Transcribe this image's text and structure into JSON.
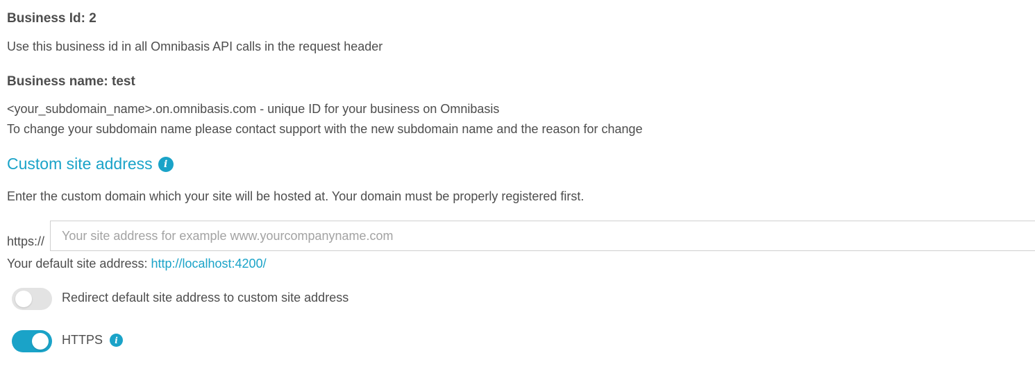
{
  "business": {
    "id_label": "Business Id: 2",
    "id_description": "Use this business id in all Omnibasis API calls in the request header",
    "name_label": "Business name: test",
    "subdomain_line": "<your_subdomain_name>.on.omnibasis.com - unique ID for your business on Omnibasis",
    "subdomain_change_note": "To change your subdomain name please contact support with the new subdomain name and the reason for change"
  },
  "custom_site": {
    "title": "Custom site address",
    "title_icon": "info-icon",
    "description": "Enter the custom domain which your site will be hosted at. Your domain must be properly registered first.",
    "prefix": "https://",
    "input_value": "",
    "input_placeholder": "Your site address for example www.yourcompanyname.com",
    "default_label": "Your default site address: ",
    "default_url": "http://localhost:4200/"
  },
  "toggles": {
    "redirect": {
      "label": "Redirect default site address to custom site address",
      "checked": false
    },
    "https": {
      "label": "HTTPS",
      "checked": true,
      "icon": "info-icon"
    }
  },
  "colors": {
    "accent": "#1aa3c8",
    "text": "#4d4d4d",
    "toggle_off": "#e3e3e3"
  }
}
